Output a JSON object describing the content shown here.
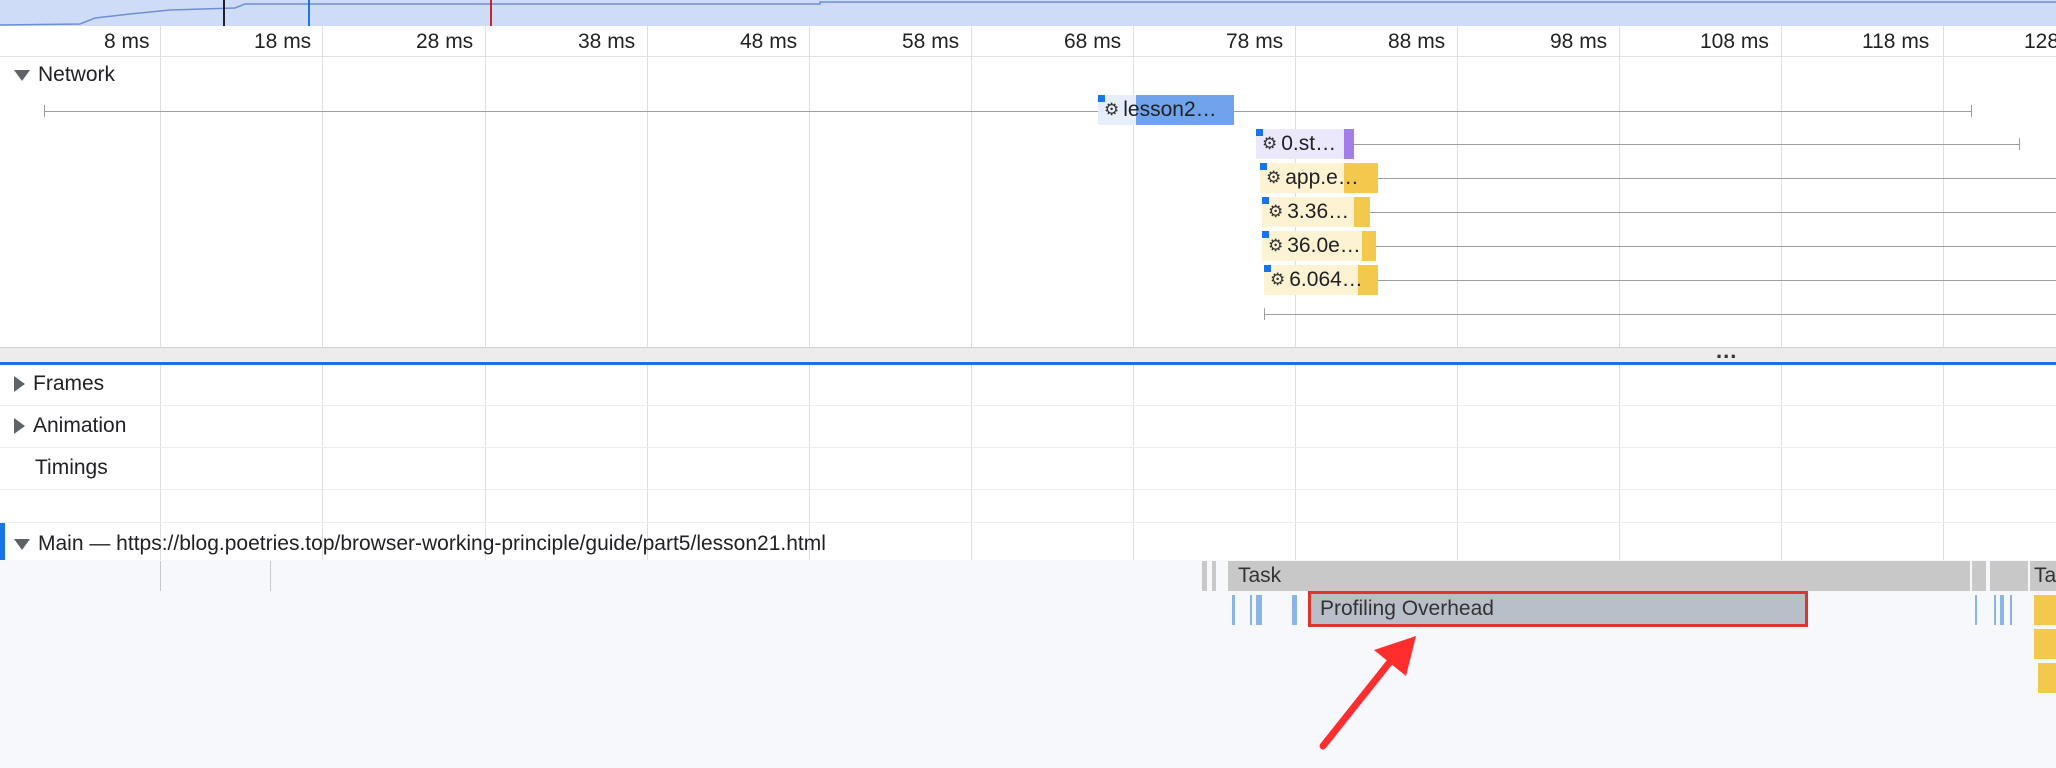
{
  "ruler": {
    "ticks": [
      "8 ms",
      "18 ms",
      "28 ms",
      "38 ms",
      "48 ms",
      "58 ms",
      "68 ms",
      "78 ms",
      "88 ms",
      "98 ms",
      "108 ms",
      "118 ms",
      "128"
    ]
  },
  "tracks": {
    "network": "Network",
    "frames": "Frames",
    "animation": "Animation",
    "timings": "Timings",
    "main": "Main — https://blog.poetries.top/browser-working-principle/guide/part5/lesson21.html"
  },
  "network_requests": [
    {
      "label": "lesson2…"
    },
    {
      "label": "0.st…"
    },
    {
      "label": "app.e…"
    },
    {
      "label": "3.36…"
    },
    {
      "label": "36.0e…"
    },
    {
      "label": "6.064…"
    }
  ],
  "separator": {
    "more": "..."
  },
  "flame": {
    "task": "Task",
    "task_right": "Ta",
    "profiling_overhead": "Profiling Overhead"
  },
  "icons": {
    "request": "gear-icon",
    "expand": "triangle-icon",
    "annotation": "arrow-icon"
  },
  "colors": {
    "highlight": "#e0352b",
    "arrow": "#ff2d2d",
    "accent": "#1a73e8",
    "script": "#f2c94c",
    "document": "#6fa3ec"
  }
}
